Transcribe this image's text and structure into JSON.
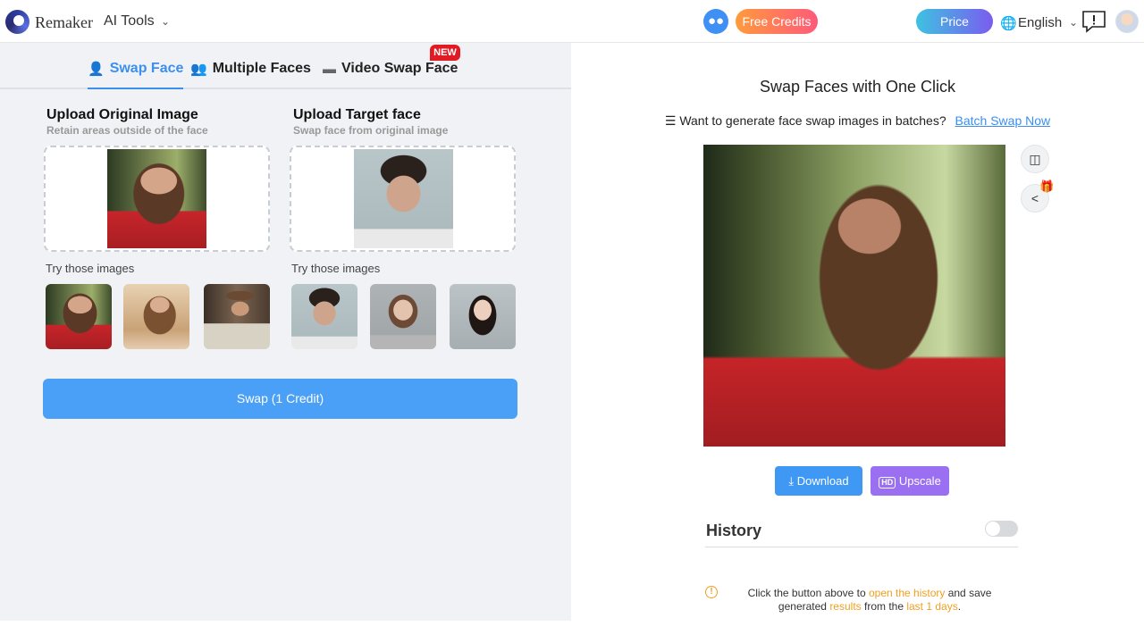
{
  "header": {
    "brand": "Remaker",
    "ai_tools": "AI Tools",
    "free_credits": "Free Credits",
    "price": "Price",
    "language": "English"
  },
  "tabs": [
    {
      "label": "Swap Face",
      "icon": "user-icon",
      "active": true
    },
    {
      "label": "Multiple Faces",
      "icon": "users-icon",
      "active": false
    },
    {
      "label": "Video Swap Face",
      "icon": "video-camera-icon",
      "active": false,
      "badge": "NEW"
    }
  ],
  "original": {
    "title": "Upload Original Image",
    "subtitle": "Retain areas outside of the face",
    "try_label": "Try those images"
  },
  "target": {
    "title": "Upload Target face",
    "subtitle": "Swap face from original image",
    "try_label": "Try those images"
  },
  "swap_button": "Swap (1 Credit)",
  "result": {
    "title": "Swap Faces with One Click",
    "batch_question": "Want to generate face swap images in batches?",
    "batch_link": "Batch Swap Now",
    "download": "Download",
    "upscale": "Upscale"
  },
  "history": {
    "title": "History",
    "enabled": false,
    "note_1": "Click the button above to ",
    "note_link_1": "open the history",
    "note_2": " and save generated ",
    "note_link_2": "results",
    "note_3": " from the ",
    "note_link_3": "last 1 days",
    "note_4": "."
  },
  "colors": {
    "accent": "#3b8ff0",
    "swap_button": "#4aa0f7",
    "upscale": "#9b6ff2",
    "warning": "#f0a020"
  }
}
